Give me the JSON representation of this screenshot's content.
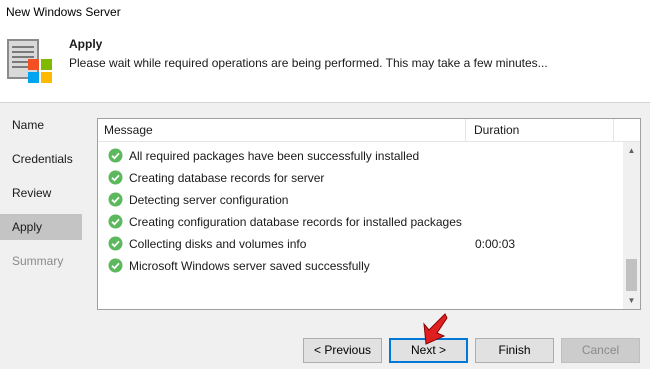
{
  "window": {
    "title": "New Windows Server"
  },
  "header": {
    "icon": "server-windows-icon",
    "title": "Apply",
    "description": "Please wait while required operations are being performed. This may take a few minutes..."
  },
  "sidebar": {
    "items": [
      {
        "label": "Name",
        "state": "normal"
      },
      {
        "label": "Credentials",
        "state": "normal"
      },
      {
        "label": "Review",
        "state": "normal"
      },
      {
        "label": "Apply",
        "state": "active"
      },
      {
        "label": "Summary",
        "state": "disabled"
      }
    ]
  },
  "log": {
    "columns": {
      "message": "Message",
      "duration": "Duration"
    },
    "rows": [
      {
        "status": "success",
        "message": "All required packages have been successfully installed",
        "duration": ""
      },
      {
        "status": "success",
        "message": "Creating database records for server",
        "duration": ""
      },
      {
        "status": "success",
        "message": "Detecting server configuration",
        "duration": ""
      },
      {
        "status": "success",
        "message": "Creating configuration database records for installed packages",
        "duration": ""
      },
      {
        "status": "success",
        "message": "Collecting disks and volumes info",
        "duration": "0:00:03"
      },
      {
        "status": "success",
        "message": "Microsoft Windows server saved successfully",
        "duration": ""
      }
    ]
  },
  "buttons": {
    "previous": "< Previous",
    "next": "Next >",
    "finish": "Finish",
    "cancel": "Cancel"
  },
  "colors": {
    "success": "#5cb85c",
    "accent": "#0078d7",
    "cursor": "#e02020"
  }
}
